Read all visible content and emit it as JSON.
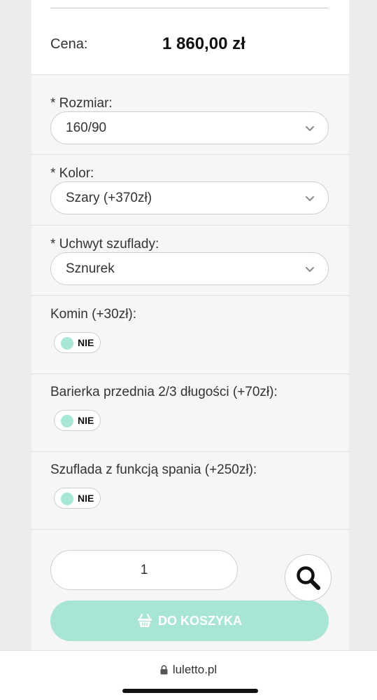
{
  "price": {
    "label": "Cena:",
    "value": "1 860,00 zł"
  },
  "options": {
    "size": {
      "label": "* Rozmiar:",
      "value": "160/90"
    },
    "color": {
      "label": "* Kolor:",
      "value": "Szary (+370zł)"
    },
    "handle": {
      "label": "* Uchwyt szuflady:",
      "value": "Sznurek"
    }
  },
  "toggles": {
    "chimney": {
      "label": "Komin (+30zł):",
      "state": "NIE"
    },
    "front_barrier": {
      "label": "Barierka przednia 2/3 długości (+70zł):",
      "state": "NIE"
    },
    "sleep_drawer": {
      "label": "Szuflada z funkcją spania (+250zł):",
      "state": "NIE"
    }
  },
  "quantity": {
    "value": "1"
  },
  "cart_button": {
    "label": "DO KOSZYKA"
  },
  "browser": {
    "url": "luletto.pl"
  },
  "icons": {
    "select_arrow": "chevron-down-icon",
    "zoom": "search-icon",
    "cart": "basket-icon",
    "lock": "lock-icon"
  },
  "colors": {
    "accent": "#a9e5d5",
    "toggle_knob": "#a8e6d6"
  }
}
